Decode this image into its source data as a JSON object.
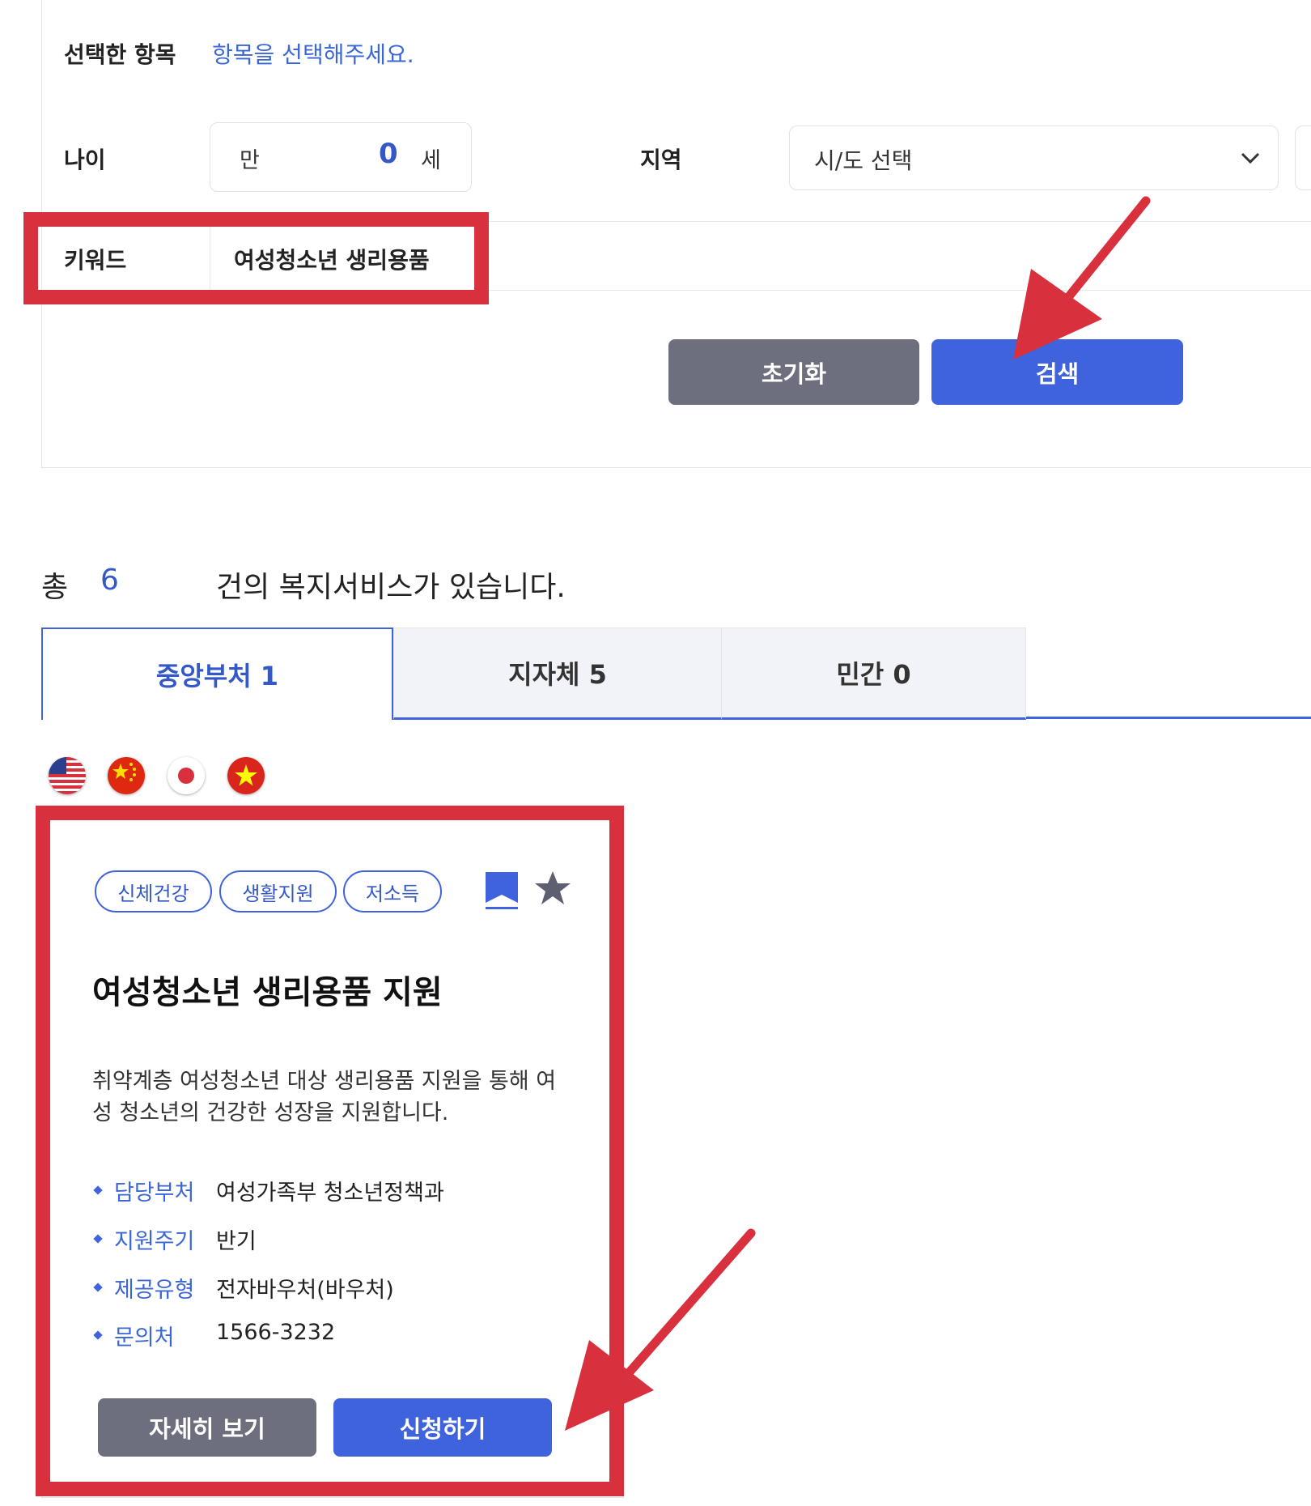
{
  "search_form": {
    "selected_label": "선택한 항목",
    "selected_placeholder": "항목을 선택해주세요.",
    "age_label": "나이",
    "age_prefix": "만",
    "age_value": "0",
    "age_suffix": "세",
    "region_label": "지역",
    "region_select_value": "시/도 선택",
    "keyword_label": "키워드",
    "keyword_value": "여성청소년 생리용품",
    "reset_button": "초기화",
    "search_button": "검색"
  },
  "results": {
    "total_prefix": "총",
    "total_count": "6",
    "total_suffix": "건의 복지서비스가 있습니다.",
    "tabs": [
      {
        "label": "중앙부처 1",
        "active": true
      },
      {
        "label": "지자체 5",
        "active": false
      },
      {
        "label": "민간 0",
        "active": false
      }
    ]
  },
  "languages": [
    "us-flag-icon",
    "china-flag-icon",
    "japan-flag-icon",
    "vietnam-flag-icon"
  ],
  "card": {
    "tags": [
      "신체건강",
      "생활지원",
      "저소득"
    ],
    "title": "여성청소년 생리용품 지원",
    "description_line1": "취약계층 여성청소년 대상 생리용품 지원을 통해 여",
    "description_line2": "성 청소년의 건강한 성장을 지원합니다.",
    "info": [
      {
        "label": "담당부처",
        "value": "여성가족부 청소년정책과"
      },
      {
        "label": "지원주기",
        "value": "반기"
      },
      {
        "label": "제공유형",
        "value": "전자바우처(바우처)"
      },
      {
        "label": "문의처",
        "value": "1566-3232"
      }
    ],
    "detail_button": "자세히 보기",
    "apply_button": "신청하기"
  },
  "colors": {
    "accent_blue": "#3e63dd",
    "button_gray": "#6d6f7e",
    "highlight_red": "#d9303e"
  }
}
